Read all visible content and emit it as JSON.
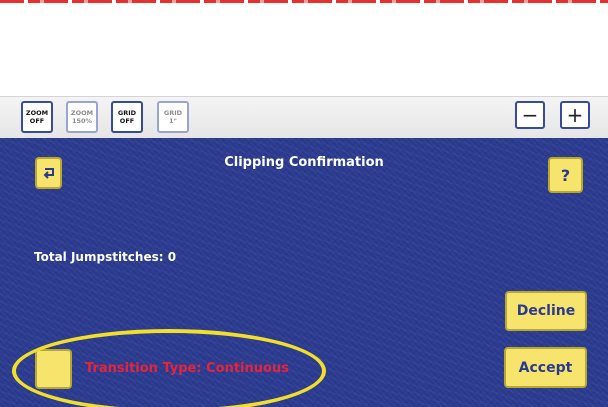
{
  "toolbar": {
    "zoom_off": [
      "ZOOM",
      "OFF"
    ],
    "zoom_150": [
      "ZOOM",
      "150%"
    ],
    "grid_off": [
      "GRID",
      "OFF"
    ],
    "grid_1in": [
      "GRID",
      "1\""
    ],
    "zoom_out_label": "−",
    "zoom_in_label": "+"
  },
  "panel": {
    "title": "Clipping Confirmation",
    "back_icon": "return-arrow-icon",
    "help_label": "?",
    "jumpstitches_text": "Total Jumpstitches: 0",
    "decline_label": "Decline",
    "accept_label": "Accept",
    "transition_text": "Transition Type: Continuous"
  },
  "colors": {
    "panel_bg": "#2a3a8f",
    "button_yellow": "#f7e46c",
    "highlight_ellipse": "#f2df2a",
    "transition_text": "#e8233a"
  }
}
